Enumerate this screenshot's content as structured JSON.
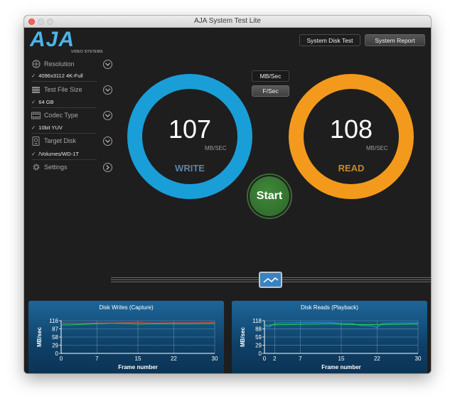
{
  "window": {
    "title": "AJA System Test Lite"
  },
  "logo": {
    "text": "AJA",
    "subtitle": "VIDEO SYSTEMS"
  },
  "sidebar": {
    "items": [
      {
        "label": "Resolution",
        "value": "4096x3112 4K-Full",
        "icon": "resolution-icon"
      },
      {
        "label": "Test File Size",
        "value": "64 GB",
        "icon": "file-size-icon"
      },
      {
        "label": "Codec Type",
        "value": "10bit YUV",
        "icon": "codec-icon"
      },
      {
        "label": "Target Disk",
        "value": "/Volumes/WD-1T",
        "icon": "disk-icon"
      },
      {
        "label": "Settings",
        "value": "",
        "icon": "gear-icon"
      }
    ],
    "check": "✓"
  },
  "toolbar": {
    "disk_test_label": "System Disk Test",
    "report_label": "System Report"
  },
  "units_toggle": {
    "mbsec_label": "MB/Sec",
    "fsec_label": "F/Sec"
  },
  "write": {
    "value": "107",
    "unit": "MB/SEC",
    "label": "WRITE",
    "color": "#1a9ed8"
  },
  "read": {
    "value": "108",
    "unit": "MB/SEC",
    "label": "READ",
    "color": "#f39a1c"
  },
  "start_label": "Start",
  "charts": {
    "writes": {
      "title": "Disk Writes (Capture)"
    },
    "reads": {
      "title": "Disk Reads (Playback)"
    }
  },
  "chart_data": [
    {
      "type": "line",
      "title": "Disk Writes (Capture)",
      "xlabel": "Frame number",
      "ylabel": "MB/sec",
      "xlim": [
        0,
        30
      ],
      "ylim": [
        0,
        116
      ],
      "xticks": [
        0,
        7,
        15,
        22,
        30
      ],
      "yticks": [
        116,
        87,
        58,
        29,
        0
      ],
      "series": [
        {
          "color": "#2bd64a",
          "x": [
            0,
            2,
            4,
            7,
            10,
            13,
            15,
            18,
            22,
            26,
            30
          ],
          "y": [
            101,
            101,
            103,
            105,
            107,
            106,
            104,
            105,
            105,
            105,
            106
          ]
        },
        {
          "color": "#e0453a",
          "x": [
            0,
            2,
            4,
            7,
            10,
            13,
            15,
            18,
            22,
            26,
            30
          ],
          "y": [
            108,
            107,
            106,
            108,
            108,
            109,
            110,
            108,
            109,
            109,
            110
          ]
        }
      ]
    },
    {
      "type": "line",
      "title": "Disk Reads (Playback)",
      "xlabel": "Frame number",
      "ylabel": "MB/sec",
      "xlim": [
        0,
        30
      ],
      "ylim": [
        0,
        118
      ],
      "xticks": [
        0,
        2,
        7,
        15,
        22,
        30
      ],
      "yticks": [
        118,
        88,
        59,
        29,
        0
      ],
      "series": [
        {
          "color": "#1a9ed8",
          "x": [
            0,
            1,
            2,
            3,
            5,
            7,
            10,
            13,
            15,
            17,
            19,
            21,
            22,
            23,
            26,
            30
          ],
          "y": [
            96,
            96,
            108,
            110,
            110,
            111,
            112,
            112,
            108,
            108,
            100,
            99,
            94,
            108,
            110,
            110
          ]
        },
        {
          "color": "#2bd64a",
          "x": [
            0,
            2,
            4,
            7,
            10,
            13,
            15,
            18,
            22,
            26,
            30
          ],
          "y": [
            101,
            103,
            104,
            105,
            106,
            107,
            105,
            104,
            104,
            105,
            106
          ]
        }
      ]
    }
  ]
}
